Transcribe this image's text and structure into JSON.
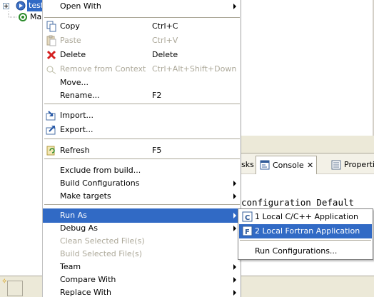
{
  "tree": {
    "project_label": "test",
    "child_label": "Mak"
  },
  "views": {
    "tasks_tab": "sks",
    "console_tab": "Console",
    "properties_tab": "Properti",
    "console_line": "configuration Default"
  },
  "menu": {
    "items": [
      {
        "label": "Open With",
        "accel": "",
        "submenu": true,
        "enabled": true,
        "icon": ""
      },
      {
        "label": "Copy",
        "accel": "Ctrl+C",
        "enabled": true,
        "icon": "copy-icon"
      },
      {
        "label": "Paste",
        "accel": "Ctrl+V",
        "enabled": false,
        "icon": "paste-icon"
      },
      {
        "label": "Delete",
        "accel": "Delete",
        "enabled": true,
        "icon": "delete-icon"
      },
      {
        "label": "Remove from Context",
        "accel": "Ctrl+Alt+Shift+Down",
        "enabled": false,
        "icon": "remove-context-icon"
      },
      {
        "label": "Move...",
        "accel": "",
        "enabled": true,
        "icon": ""
      },
      {
        "label": "Rename...",
        "accel": "F2",
        "enabled": true,
        "icon": ""
      },
      {
        "label": "Import...",
        "accel": "",
        "enabled": true,
        "icon": "import-icon"
      },
      {
        "label": "Export...",
        "accel": "",
        "enabled": true,
        "icon": "export-icon"
      },
      {
        "label": "Refresh",
        "accel": "F5",
        "enabled": true,
        "icon": "refresh-icon"
      },
      {
        "label": "Exclude from build...",
        "accel": "",
        "enabled": true,
        "icon": ""
      },
      {
        "label": "Build Configurations",
        "accel": "",
        "submenu": true,
        "enabled": true,
        "icon": ""
      },
      {
        "label": "Make targets",
        "accel": "",
        "submenu": true,
        "enabled": true,
        "icon": ""
      },
      {
        "label": "Run As",
        "accel": "",
        "submenu": true,
        "enabled": true,
        "selected": true,
        "icon": ""
      },
      {
        "label": "Debug As",
        "accel": "",
        "submenu": true,
        "enabled": true,
        "icon": ""
      },
      {
        "label": "Clean Selected File(s)",
        "accel": "",
        "enabled": false,
        "icon": ""
      },
      {
        "label": "Build Selected File(s)",
        "accel": "",
        "enabled": false,
        "icon": ""
      },
      {
        "label": "Team",
        "accel": "",
        "submenu": true,
        "enabled": true,
        "icon": ""
      },
      {
        "label": "Compare With",
        "accel": "",
        "submenu": true,
        "enabled": true,
        "icon": ""
      },
      {
        "label": "Replace With",
        "accel": "",
        "submenu": true,
        "enabled": true,
        "icon": ""
      }
    ]
  },
  "run_as_submenu": {
    "items": [
      {
        "label": "1 Local C/C++ Application",
        "icon": "c-app-icon"
      },
      {
        "label": "2 Local Fortran Application",
        "icon": "fortran-app-icon",
        "selected": true
      },
      {
        "label": "Run Configurations...",
        "icon": ""
      }
    ]
  },
  "colors": {
    "selection": "#316ac5",
    "disabled_text": "#aca899",
    "toolbar_bg": "#ece9d8"
  }
}
